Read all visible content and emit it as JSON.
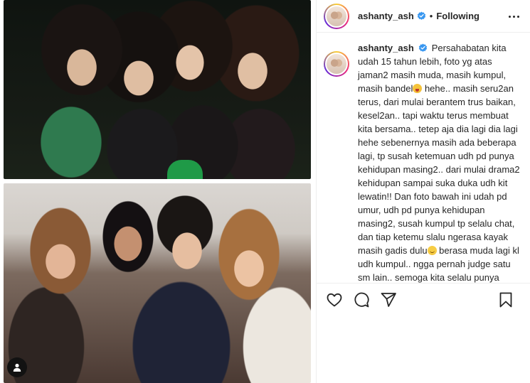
{
  "header": {
    "username": "ashanty_ash",
    "separator": "•",
    "follow_status": "Following"
  },
  "caption": {
    "username": "ashanty_ash",
    "text_part1": "Persahabatan kita udah 15 tahun lebih, foto yg atas jaman2 masih muda, masih kumpul, masih bandel",
    "text_part2": " hehe.. masih seru2an terus, dari mulai berantem trus baikan, kesel2an.. tapi waktu terus membuat kita bersama.. tetep aja dia lagi dia lagi hehe sebenernya masih ada beberapa lagi, tp susah ketemuan udh pd punya kehidupan masing2.. dari mulai drama2 kehidupan sampai suka duka udh kit lewatin!! Dan foto bawah ini udah pd umur, udh pd punya kehidupan masing2, susah kumpul tp selalu chat, dan tiap ketemu slalu ngerasa kayak masih gadis dulu",
    "text_part3": " berasa muda lagi kl udh kumpul.. ngga pernah judge satu sm lain.. semoga kita selalu punya waktu untuk"
  },
  "icons": {
    "verified": "verified-badge-icon",
    "more": "more-options-icon",
    "like": "heart-icon",
    "comment": "comment-icon",
    "share": "paper-plane-icon",
    "save": "bookmark-icon",
    "tag": "user-tag-icon"
  },
  "colors": {
    "verified": "#3897f0",
    "text": "#262626",
    "border": "#efefef"
  }
}
